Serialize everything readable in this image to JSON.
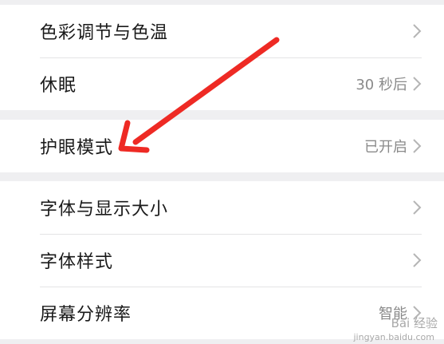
{
  "settings": {
    "color_temp": {
      "label": "色彩调节与色温"
    },
    "sleep": {
      "label": "休眠",
      "value": "30 秒后"
    },
    "eye_care": {
      "label": "护眼模式",
      "value": "已开启"
    },
    "font_display_size": {
      "label": "字体与显示大小"
    },
    "font_style": {
      "label": "字体样式"
    },
    "resolution": {
      "label": "屏幕分辨率",
      "value": "智能"
    }
  },
  "annotation": {
    "color": "#ee2a24"
  },
  "watermark": {
    "text": "Bai 经验",
    "subtext": "jingyan.baidu.com"
  },
  "icons": {
    "chevron": "chevron-right-icon",
    "annotation": "red-arrow"
  }
}
